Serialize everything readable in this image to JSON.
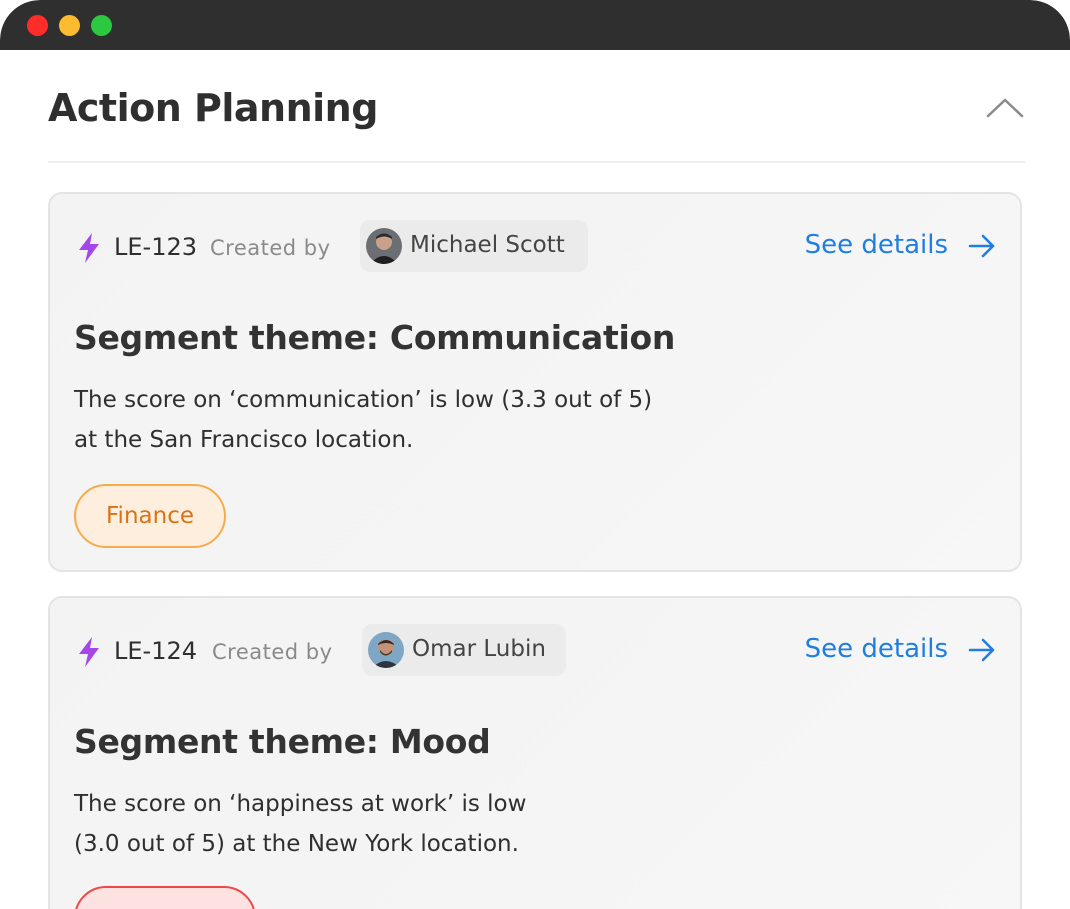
{
  "window": {
    "controls": [
      "close",
      "minimize",
      "maximize"
    ]
  },
  "header": {
    "title": "Action Planning",
    "collapse_icon": "chevron-up-icon"
  },
  "cards": [
    {
      "id": "LE-123",
      "created_by_label": "Created by",
      "user": "Michael Scott",
      "see_details": "See details",
      "theme": "Segment theme: Communication",
      "description_line1": "The score on ‘communication’ is low  (3.3 out of 5)",
      "description_line2": "at the San Francisco location.",
      "tag": "Finance"
    },
    {
      "id": "LE-124",
      "created_by_label": "Created by",
      "user": "Omar Lubin",
      "see_details": "See details",
      "theme": "Segment theme: Mood",
      "description_line1": "The score on ‘happiness at work’ is low",
      "description_line2": "(3.0 out of 5) at the New York location.",
      "tag": ""
    }
  ],
  "colors": {
    "accent": "#1f7ee0",
    "bolt": "#a547e8",
    "finance_tag": "#d97316",
    "red_tag": "#f04747"
  }
}
